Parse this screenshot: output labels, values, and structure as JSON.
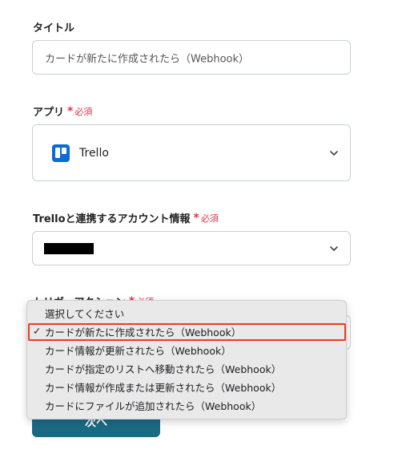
{
  "title_field": {
    "label": "タイトル",
    "value": "カードが新たに作成されたら（Webhook）"
  },
  "app_field": {
    "label": "アプリ",
    "required": "必須",
    "value": "Trello",
    "icon": "trello-logo-icon"
  },
  "account_field": {
    "label": "Trelloと連携するアカウント情報",
    "required": "必須"
  },
  "trigger_field": {
    "label": "トリガーアクション",
    "required": "必須"
  },
  "dropdown": {
    "options": [
      "選択してください",
      "カードが新たに作成されたら（Webhook）",
      "カード情報が更新されたら（Webhook）",
      "カードが指定のリストへ移動されたら（Webhook）",
      "カード情報が作成または更新されたら（Webhook）",
      "カードにファイルが追加されたら（Webhook）"
    ],
    "selected_index": 1
  },
  "next_button": {
    "label": "次へ"
  },
  "colors": {
    "required": "#e0344a",
    "button": "#1a6a84",
    "trello": "#0a6ad8",
    "highlight": "#ef3b1b"
  }
}
